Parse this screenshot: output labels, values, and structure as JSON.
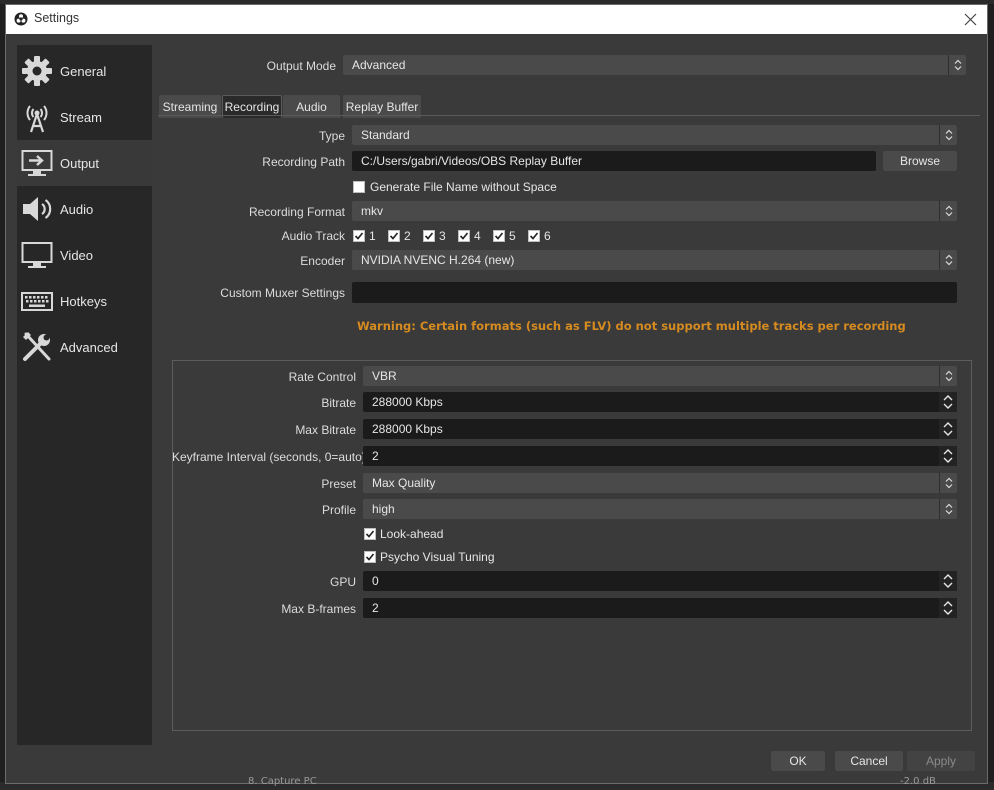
{
  "window": {
    "title": "Settings"
  },
  "background": {
    "bottom_text": "8. Capture PC",
    "bottom_db": "-2.0 dB"
  },
  "sidebar": {
    "items": [
      {
        "label": "General",
        "icon": "gear-icon"
      },
      {
        "label": "Stream",
        "icon": "broadcast-icon"
      },
      {
        "label": "Output",
        "icon": "monitor-output-icon",
        "active": true
      },
      {
        "label": "Audio",
        "icon": "speaker-icon"
      },
      {
        "label": "Video",
        "icon": "monitor-icon"
      },
      {
        "label": "Hotkeys",
        "icon": "keyboard-icon"
      },
      {
        "label": "Advanced",
        "icon": "tools-icon"
      }
    ]
  },
  "output_mode": {
    "label": "Output Mode",
    "value": "Advanced"
  },
  "tabs": [
    {
      "label": "Streaming"
    },
    {
      "label": "Recording",
      "active": true
    },
    {
      "label": "Audio"
    },
    {
      "label": "Replay Buffer"
    }
  ],
  "recording": {
    "type": {
      "label": "Type",
      "value": "Standard"
    },
    "path": {
      "label": "Recording Path",
      "value": "C:/Users/gabri/Videos/OBS Replay Buffer",
      "browse": "Browse"
    },
    "no_space": {
      "label": "Generate File Name without Space",
      "checked": false
    },
    "format": {
      "label": "Recording Format",
      "value": "mkv"
    },
    "audio_track": {
      "label": "Audio Track",
      "tracks": [
        {
          "label": "1",
          "checked": true
        },
        {
          "label": "2",
          "checked": true
        },
        {
          "label": "3",
          "checked": true
        },
        {
          "label": "4",
          "checked": true
        },
        {
          "label": "5",
          "checked": true
        },
        {
          "label": "6",
          "checked": true
        }
      ]
    },
    "encoder": {
      "label": "Encoder",
      "value": "NVIDIA NVENC H.264 (new)"
    },
    "muxer": {
      "label": "Custom Muxer Settings",
      "value": ""
    },
    "warning": "Warning: Certain formats (such as FLV) do not support multiple tracks per recording"
  },
  "encoder_settings": {
    "rate_control": {
      "label": "Rate Control",
      "value": "VBR"
    },
    "bitrate": {
      "label": "Bitrate",
      "value": "288000 Kbps"
    },
    "max_bitrate": {
      "label": "Max Bitrate",
      "value": "288000 Kbps"
    },
    "keyframe": {
      "label": "Keyframe Interval (seconds, 0=auto)",
      "value": "2"
    },
    "preset": {
      "label": "Preset",
      "value": "Max Quality"
    },
    "profile": {
      "label": "Profile",
      "value": "high"
    },
    "look_ahead": {
      "label": "Look-ahead",
      "checked": true
    },
    "psycho_visual": {
      "label": "Psycho Visual Tuning",
      "checked": true
    },
    "gpu": {
      "label": "GPU",
      "value": "0"
    },
    "max_bframes": {
      "label": "Max B-frames",
      "value": "2"
    }
  },
  "footer": {
    "ok": "OK",
    "cancel": "Cancel",
    "apply": "Apply"
  }
}
